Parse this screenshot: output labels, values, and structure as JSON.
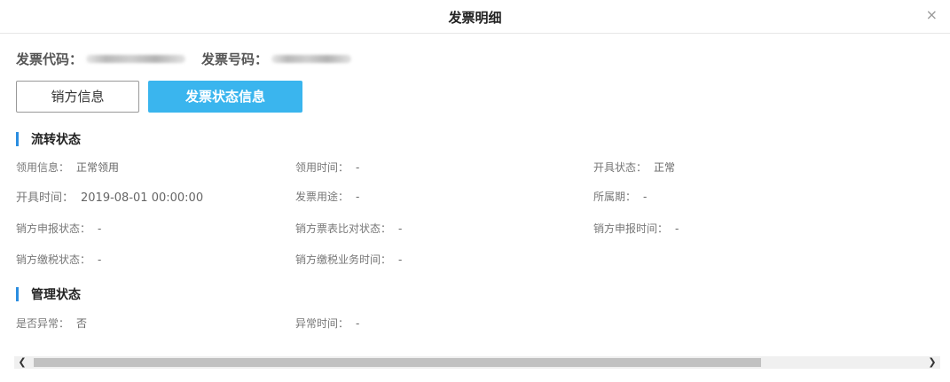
{
  "dialog": {
    "title": "发票明细",
    "close_symbol": "×"
  },
  "invoice": {
    "code_label": "发票代码：",
    "number_label": "发票号码："
  },
  "tabs": [
    {
      "label": "销方信息",
      "active": false
    },
    {
      "label": "发票状态信息",
      "active": true
    }
  ],
  "sections": {
    "flow": {
      "title": "流转状态",
      "fields": [
        {
          "label": "领用信息：",
          "value": "正常领用"
        },
        {
          "label": "领用时间：",
          "value": "-"
        },
        {
          "label": "开具状态：",
          "value": "正常"
        },
        {
          "label": "开具时间：",
          "value": "2019-08-01 00:00:00"
        },
        {
          "label": "发票用途：",
          "value": "-"
        },
        {
          "label": "所属期：",
          "value": "-"
        },
        {
          "label": "销方申报状态：",
          "value": "-"
        },
        {
          "label": "销方票表比对状态：",
          "value": "-"
        },
        {
          "label": "销方申报时间：",
          "value": "-"
        },
        {
          "label": "销方缴税状态：",
          "value": "-"
        },
        {
          "label": "销方缴税业务时间：",
          "value": "-"
        }
      ]
    },
    "management": {
      "title": "管理状态",
      "fields": [
        {
          "label": "是否异常：",
          "value": "否"
        },
        {
          "label": "异常时间：",
          "value": "-"
        }
      ]
    }
  },
  "scrollbar": {
    "left_arrow": "❮",
    "right_arrow": "❯"
  },
  "colors": {
    "accent": "#3ab5ee",
    "section_bar": "#2a8de0"
  }
}
